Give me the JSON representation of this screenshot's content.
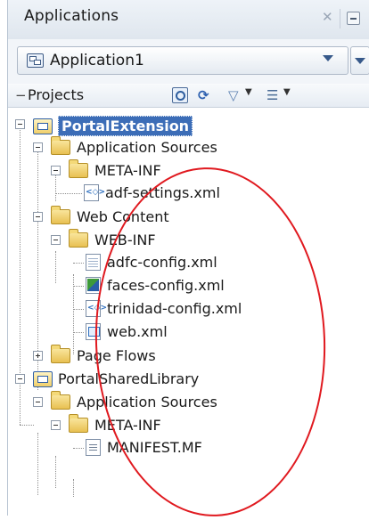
{
  "panel": {
    "title": "Applications"
  },
  "application": {
    "selected": "Application1"
  },
  "projects_toolbar": {
    "label": "Projects"
  },
  "tree": [
    {
      "label": "PortalExtension",
      "kind": "project",
      "selected": true
    },
    {
      "label": "Application Sources",
      "kind": "folder"
    },
    {
      "label": "META-INF",
      "kind": "folder"
    },
    {
      "label": "adf-settings.xml",
      "kind": "file"
    },
    {
      "label": "Web Content",
      "kind": "folder"
    },
    {
      "label": "WEB-INF",
      "kind": "folder"
    },
    {
      "label": "adfc-config.xml",
      "kind": "file"
    },
    {
      "label": "faces-config.xml",
      "kind": "file"
    },
    {
      "label": "trinidad-config.xml",
      "kind": "file"
    },
    {
      "label": "web.xml",
      "kind": "file"
    },
    {
      "label": "Page Flows",
      "kind": "folder"
    },
    {
      "label": "PortalSharedLibrary",
      "kind": "project"
    },
    {
      "label": "Application Sources",
      "kind": "folder"
    },
    {
      "label": "META-INF",
      "kind": "folder"
    },
    {
      "label": "MANIFEST.MF",
      "kind": "file"
    }
  ],
  "colors": {
    "selection": "#3c6db7",
    "annotation_circle": "#e0191f"
  }
}
